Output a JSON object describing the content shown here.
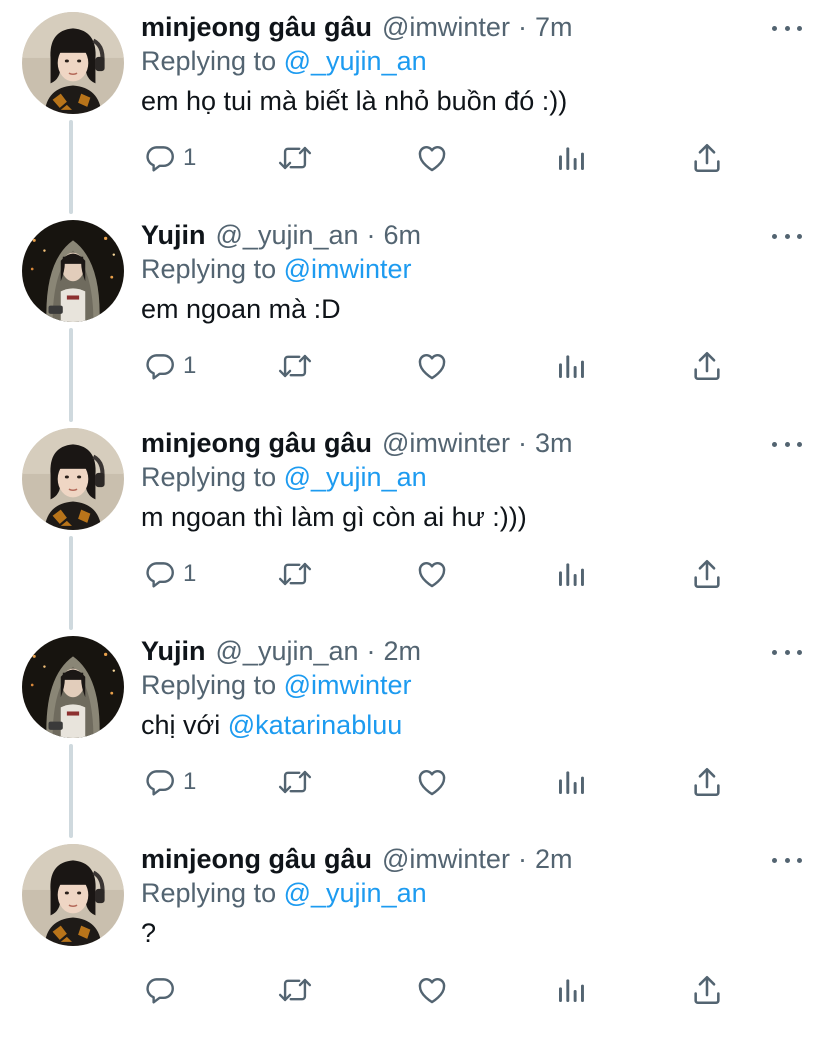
{
  "tweets": [
    {
      "author": "minjeong",
      "name": "minjeong gâu gâu",
      "handle": "@imwinter",
      "sep": "·",
      "time": "7m",
      "reply_prefix": "Replying to",
      "reply_to": "@_yujin_an",
      "text": "em họ tui mà biết là nhỏ buồn đó :))",
      "mention": "",
      "reply_count": "1"
    },
    {
      "author": "yujin",
      "name": "Yujin",
      "handle": "@_yujin_an",
      "sep": "·",
      "time": "6m",
      "reply_prefix": "Replying to",
      "reply_to": "@imwinter",
      "text": "em ngoan mà :D",
      "mention": "",
      "reply_count": "1"
    },
    {
      "author": "minjeong",
      "name": "minjeong gâu gâu",
      "handle": "@imwinter",
      "sep": "·",
      "time": "3m",
      "reply_prefix": "Replying to",
      "reply_to": "@_yujin_an",
      "text": "m ngoan thì làm gì còn ai hư :)))",
      "mention": "",
      "reply_count": "1"
    },
    {
      "author": "yujin",
      "name": "Yujin",
      "handle": "@_yujin_an",
      "sep": "·",
      "time": "2m",
      "reply_prefix": "Replying to",
      "reply_to": "@imwinter",
      "text": "chị với ",
      "mention": "@katarinabluu",
      "reply_count": "1"
    },
    {
      "author": "minjeong",
      "name": "minjeong gâu gâu",
      "handle": "@imwinter",
      "sep": "·",
      "time": "2m",
      "reply_prefix": "Replying to",
      "reply_to": "@_yujin_an",
      "text": "?",
      "mention": "",
      "reply_count": ""
    }
  ],
  "icons": {
    "reply": "reply-icon",
    "retweet": "retweet-icon",
    "like": "like-icon",
    "analytics": "analytics-icon",
    "share": "share-icon",
    "more": "more-icon"
  },
  "colors": {
    "name": "#0f1419",
    "secondary": "#536471",
    "mention": "#1d9bf0",
    "thread_line": "#cfd9de",
    "background": "#ffffff"
  }
}
